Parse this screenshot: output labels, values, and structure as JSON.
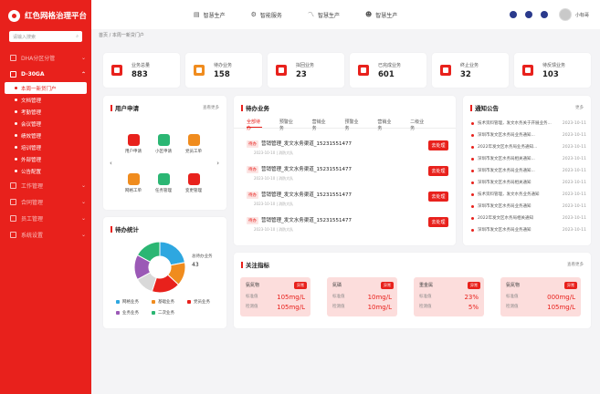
{
  "app": {
    "title": "红色网格治理平台"
  },
  "sidebar": {
    "search_placeholder": "请输入搜索",
    "sections": [
      {
        "label": "DHA分区分管",
        "expanded": false
      },
      {
        "label": "D-30GA",
        "expanded": true
      }
    ],
    "items": [
      {
        "label": "本周一新贷门户",
        "active": true
      },
      {
        "label": "文档管理"
      },
      {
        "label": "考勤管理"
      },
      {
        "label": "会议管理"
      },
      {
        "label": "绩效管理"
      },
      {
        "label": "培训管理"
      },
      {
        "label": "外部管理"
      },
      {
        "label": "公告配置"
      }
    ],
    "bottom_sections": [
      {
        "label": "工作管理"
      },
      {
        "label": "合同管理"
      },
      {
        "label": "员工管理"
      },
      {
        "label": "系统设置"
      }
    ]
  },
  "topbar": {
    "nav": [
      {
        "label": "智慧生产",
        "icon": "chart-icon"
      },
      {
        "label": "智能服务",
        "icon": "gear-icon"
      },
      {
        "label": "智慧生产",
        "icon": "trend-icon"
      },
      {
        "label": "智慧生产",
        "icon": "users-icon"
      }
    ],
    "username": "小标哥"
  },
  "breadcrumb": "首页 / 本周一新贷门户",
  "stats": [
    {
      "label": "业务总量",
      "value": "883",
      "color": "#e8211c"
    },
    {
      "label": "待办业务",
      "value": "158",
      "color": "#f08c1e"
    },
    {
      "label": "拟回业务",
      "value": "23",
      "color": "#e8211c"
    },
    {
      "label": "已完成业务",
      "value": "601",
      "color": "#e8211c"
    },
    {
      "label": "终止业务",
      "value": "32",
      "color": "#e8211c"
    },
    {
      "label": "待反馈业务",
      "value": "103",
      "color": "#e8211c"
    }
  ],
  "user_apps": {
    "title": "用户申请",
    "more": "查看更多",
    "apps": [
      {
        "label": "用户申请",
        "color": "#e8211c"
      },
      {
        "label": "小区申请",
        "color": "#2bb673"
      },
      {
        "label": "党员工单",
        "color": "#f08c1e"
      },
      {
        "label": "网格工单",
        "color": "#f08c1e"
      },
      {
        "label": "任务管理",
        "color": "#2bb673"
      },
      {
        "label": "变更管理",
        "color": "#e8211c"
      }
    ]
  },
  "pending_stats": {
    "title": "待办统计",
    "total_label": "总待办业务",
    "total": "43",
    "legend": [
      {
        "label": "网格业务",
        "color": "#2ea7e0"
      },
      {
        "label": "基础业务",
        "color": "#f08c1e"
      },
      {
        "label": "党员业务",
        "color": "#e8211c"
      },
      {
        "label": "业务业务",
        "color": "#9b59b6"
      },
      {
        "label": "二次业务",
        "color": "#2bb673"
      }
    ]
  },
  "chart_data": {
    "type": "pie",
    "slices": [
      {
        "label": "网格业务",
        "value": 22,
        "color": "#2ea7e0"
      },
      {
        "label": "基础业务",
        "value": 15,
        "color": "#f08c1e"
      },
      {
        "label": "党员业务",
        "value": 18,
        "color": "#e8211c"
      },
      {
        "label": "业务业务",
        "value": 12,
        "color": "#d9d9d9"
      },
      {
        "label": "二次业务",
        "value": 16,
        "color": "#9b59b6"
      },
      {
        "label": "其他业务",
        "value": 17,
        "color": "#2bb673"
      }
    ]
  },
  "tasks": {
    "title": "待办业务",
    "tabs": [
      "全部待办",
      "预警业务",
      "营销业务",
      "预警业务",
      "营销业务",
      "二级业务"
    ],
    "items": [
      {
        "tag": "待办",
        "title": "营销管理_发文水务渠道_15231551477",
        "sub": "2023-10-10 | 消防大队",
        "button": "去处理"
      },
      {
        "tag": "待办",
        "title": "营销管理_发文水务渠道_15231551477",
        "sub": "2023-10-10 | 消防大队",
        "button": "去处理"
      },
      {
        "tag": "待办",
        "title": "营销管理_发文水务渠道_15231551477",
        "sub": "2023-10-10 | 消防大队",
        "button": "去处理"
      },
      {
        "tag": "待办",
        "title": "营销管理_发文水务渠道_15231551477",
        "sub": "2023-10-10 | 消防大队",
        "button": "去处理"
      }
    ]
  },
  "notices": {
    "title": "通知公告",
    "more": "更多",
    "items": [
      {
        "text": "技术资料管理，发文水务关于开展业务...",
        "date": "2023-10-11"
      },
      {
        "text": "深圳市发文区水务局业务通知...",
        "date": "2023-10-11"
      },
      {
        "text": "2022年发文区水务局业务通知...",
        "date": "2023-10-11"
      },
      {
        "text": "深圳市发文区水务局相关通知...",
        "date": "2023-10-11"
      },
      {
        "text": "深圳市发文区水务局业务通知...",
        "date": "2023-10-11"
      },
      {
        "text": "深圳市发文区水务局相关通知",
        "date": "2023-10-11"
      },
      {
        "text": "技术资料管理，发文水务业务通知",
        "date": "2023-10-11"
      },
      {
        "text": "深圳市发文区水务局业务通知",
        "date": "2023-10-11"
      },
      {
        "text": "2022年发文区水务局相关通知",
        "date": "2023-10-11"
      },
      {
        "text": "深圳市发文区水务局业务通知",
        "date": "2023-10-11"
      }
    ]
  },
  "indicators": {
    "title": "关注指标",
    "more": "查看更多",
    "cards": [
      {
        "name": "氨氮物",
        "badge": "异常",
        "k1": "标准值",
        "v1": "105mg/L",
        "k2": "检测值",
        "v2": "105mg/L"
      },
      {
        "name": "氮磷",
        "badge": "异常",
        "k1": "标准值",
        "v1": "10mg/L",
        "k2": "检测值",
        "v2": "10mg/L"
      },
      {
        "name": "重金属",
        "badge": "异常",
        "k1": "标准值",
        "v1": "23%",
        "k2": "检测值",
        "v2": "5%"
      },
      {
        "name": "氨氮物",
        "badge": "异常",
        "k1": "标准值",
        "v1": "000mg/L",
        "k2": "检测值",
        "v2": "105mg/L"
      }
    ]
  }
}
